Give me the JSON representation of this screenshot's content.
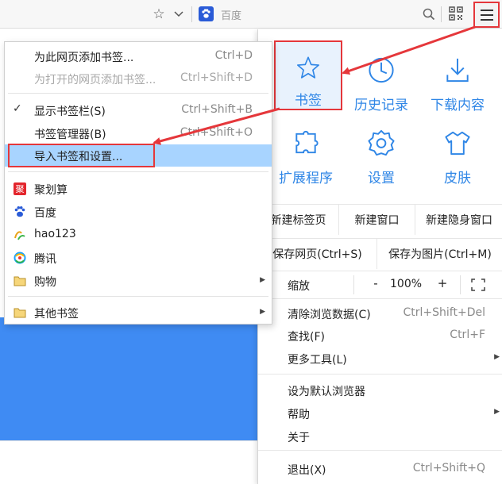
{
  "toolbar": {
    "search_label": "百度"
  },
  "grid": [
    {
      "label": "书签",
      "icon": "star-icon",
      "active": true
    },
    {
      "label": "历史记录",
      "icon": "clock-icon"
    },
    {
      "label": "下载内容",
      "icon": "download-icon"
    },
    {
      "label": "扩展程序",
      "icon": "extension-icon"
    },
    {
      "label": "设置",
      "icon": "gear-icon"
    },
    {
      "label": "皮肤",
      "icon": "shirt-icon"
    }
  ],
  "new_row": [
    "新建标签页",
    "新建窗口",
    "新建隐身窗口"
  ],
  "save_row": [
    "保存网页(Ctrl+S)",
    "保存为图片(Ctrl+M)"
  ],
  "zoom": {
    "label": "缩放",
    "minus": "-",
    "value": "100%",
    "plus": "+"
  },
  "menu_items": [
    {
      "label": "清除浏览数据(C)",
      "shortcut": "Ctrl+Shift+Del"
    },
    {
      "label": "查找(F)",
      "shortcut": "Ctrl+F"
    },
    {
      "label": "更多工具(L)",
      "shortcut": "",
      "submenu": true
    },
    {
      "label": "设为默认浏览器",
      "shortcut": ""
    },
    {
      "label": "帮助",
      "shortcut": "",
      "submenu": true
    },
    {
      "label": "关于",
      "shortcut": ""
    },
    {
      "label": "退出(X)",
      "shortcut": "Ctrl+Shift+Q"
    }
  ],
  "submenu": {
    "items": [
      {
        "label": "为此网页添加书签...",
        "shortcut": "Ctrl+D"
      },
      {
        "label": "为打开的网页添加书签...",
        "shortcut": "Ctrl+Shift+D",
        "disabled": true
      },
      {
        "label": "显示书签栏(S)",
        "shortcut": "Ctrl+Shift+B",
        "checked": true
      },
      {
        "label": "书签管理器(B)",
        "shortcut": "Ctrl+Shift+O"
      },
      {
        "label": "导入书签和设置...",
        "shortcut": "",
        "highlighted": true
      }
    ],
    "bookmarks": [
      {
        "label": "聚划算",
        "icon": "juhuasuan-icon"
      },
      {
        "label": "百度",
        "icon": "baidu-paw-icon"
      },
      {
        "label": "hao123",
        "icon": "hao123-icon"
      },
      {
        "label": "腾讯",
        "icon": "tencent-icon"
      },
      {
        "label": "购物",
        "icon": "folder-icon",
        "submenu": true
      }
    ],
    "other": {
      "label": "其他书签",
      "icon": "folder-icon",
      "submenu": true
    }
  },
  "colors": {
    "accent": "#2f86e6",
    "highlight_red": "#e5373b",
    "selection": "#a8d4ff",
    "page_blue": "#3f8bf3"
  }
}
